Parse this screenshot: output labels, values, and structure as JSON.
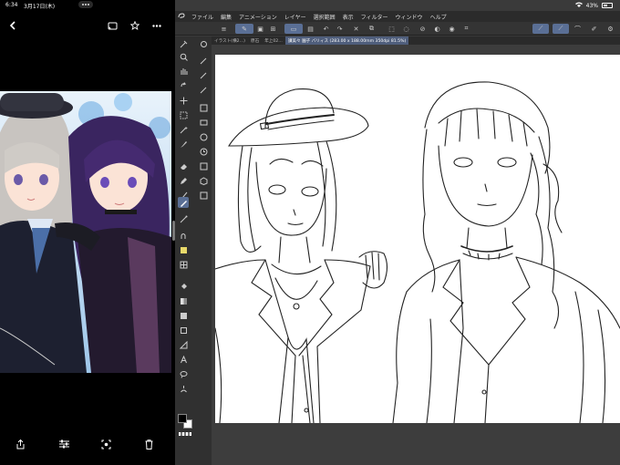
{
  "status": {
    "time": "6:34",
    "date": "3月17日(木)",
    "battery": "43%"
  },
  "viewer": {
    "icons": [
      "chevron-left-icon",
      "cast-icon",
      "star-icon",
      "more-icon",
      "share-icon",
      "adjust-icon",
      "lens-icon",
      "trash-icon"
    ]
  },
  "app": {
    "menu": [
      "ファイル",
      "編集",
      "アニメーション",
      "レイヤー",
      "選択範囲",
      "表示",
      "フィルター",
      "ウィンドウ",
      "ヘルプ"
    ],
    "tabs": [
      {
        "label": "イラスト(横2…)"
      },
      {
        "label": "原石"
      },
      {
        "label": "年上02…"
      },
      {
        "label": "讃美々 園子 バリィス (283.00 x 188.00mm 350dpi 81.5%)"
      }
    ],
    "colors": {
      "accent": "#5a6f95",
      "panel": "#303030",
      "canvas": "#ffffff"
    }
  }
}
